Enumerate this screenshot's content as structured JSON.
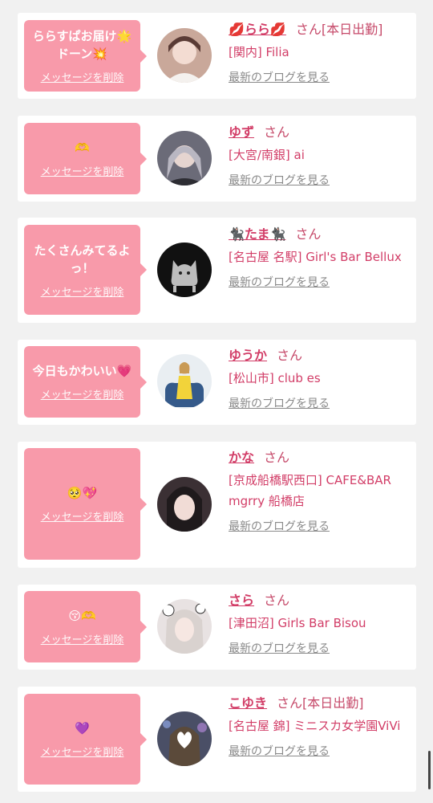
{
  "items": [
    {
      "message": "ららすぱお届け🌟ドーン💥",
      "delete_label": "メッセージを削除",
      "name": "💋らら💋",
      "honorific": "さん",
      "work_status": "[本日出勤]",
      "shop": "[関内] Filia",
      "blog_label": "最新のブログを見る",
      "avatar_color": "#c9a89a"
    },
    {
      "message": "🫶",
      "delete_label": "メッセージを削除",
      "name": "ゆず",
      "honorific": "さん",
      "work_status": "",
      "shop": "[大宮/南銀] ai",
      "blog_label": "最新のブログを見る",
      "avatar_color": "#6b6b78"
    },
    {
      "message": "たくさんみてるよっ！",
      "delete_label": "メッセージを削除",
      "name": "🐈‍⬛たま🐈‍⬛",
      "honorific": "さん",
      "work_status": "",
      "shop": "[名古屋 名駅] Girl's Bar Bellux",
      "blog_label": "最新のブログを見る",
      "avatar_color": "#111111"
    },
    {
      "message": "今日もかわいい💗",
      "delete_label": "メッセージを削除",
      "name": "ゆうか",
      "honorific": "さん",
      "work_status": "",
      "shop": "[松山市] club es",
      "blog_label": "最新のブログを見る",
      "avatar_color": "#e9eef2"
    },
    {
      "message": "🥺💖",
      "delete_label": "メッセージを削除",
      "name": "かな",
      "honorific": "さん",
      "work_status": "",
      "shop": "[京成船橋駅西口] CAFE&BAR mgrry 船橋店",
      "blog_label": "最新のブログを見る",
      "avatar_color": "#3b3034"
    },
    {
      "message": "😚🫶",
      "delete_label": "メッセージを削除",
      "name": "さら",
      "honorific": "さん",
      "work_status": "",
      "shop": "[津田沼] Girls Bar Bisou",
      "blog_label": "最新のブログを見る",
      "avatar_color": "#e8e2e2"
    },
    {
      "message": "💜",
      "delete_label": "メッセージを削除",
      "name": "こゆき",
      "honorific": "さん",
      "work_status": "[本日出勤]",
      "shop": "[名古屋 錦] ミニスカ女学園ViVi",
      "blog_label": "最新のブログを見る",
      "avatar_color": "#4a4f66"
    }
  ]
}
